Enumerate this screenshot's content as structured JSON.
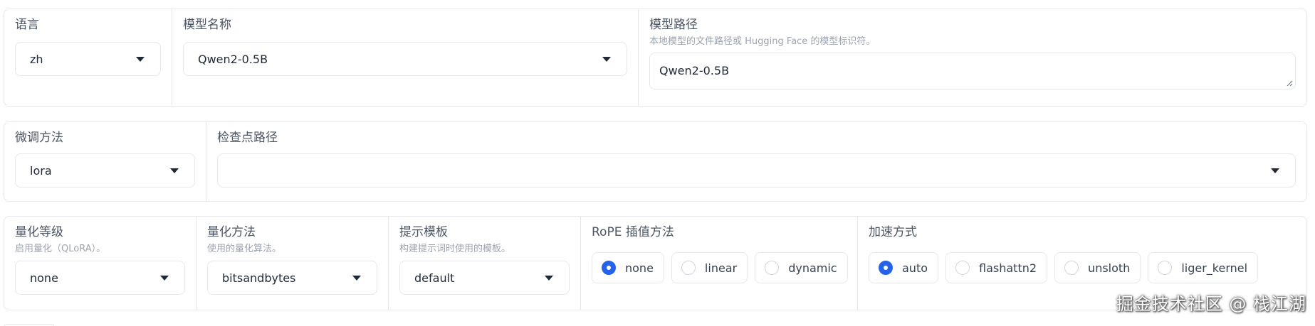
{
  "row1": {
    "language": {
      "label": "语言",
      "value": "zh"
    },
    "model_name": {
      "label": "模型名称",
      "value": "Qwen2-0.5B"
    },
    "model_path": {
      "label": "模型路径",
      "info": "本地模型的文件路径或 Hugging Face 的模型标识符。",
      "value": "Qwen2-0.5B"
    }
  },
  "row2": {
    "finetuning_type": {
      "label": "微调方法",
      "value": "lora"
    },
    "checkpoint_path": {
      "label": "检查点路径",
      "value": ""
    }
  },
  "row3": {
    "quantization_bit": {
      "label": "量化等级",
      "info": "启用量化（QLoRA）。",
      "value": "none"
    },
    "quantization_method": {
      "label": "量化方法",
      "info": "使用的量化算法。",
      "value": "bitsandbytes"
    },
    "template": {
      "label": "提示模板",
      "info": "构建提示词时使用的模板。",
      "value": "default"
    },
    "rope_scaling": {
      "label": "RoPE 插值方法",
      "options": [
        "none",
        "linear",
        "dynamic"
      ],
      "selected": "none"
    },
    "booster": {
      "label": "加速方式",
      "options": [
        "auto",
        "flashattn2",
        "unsloth",
        "liger_kernel"
      ],
      "selected": "auto"
    }
  },
  "watermark": "掘金技术社区 @ 栈江湖",
  "colors": {
    "accent": "#2563eb",
    "border": "#e5e7eb",
    "label": "#4b5563",
    "info": "#9ca3af"
  }
}
